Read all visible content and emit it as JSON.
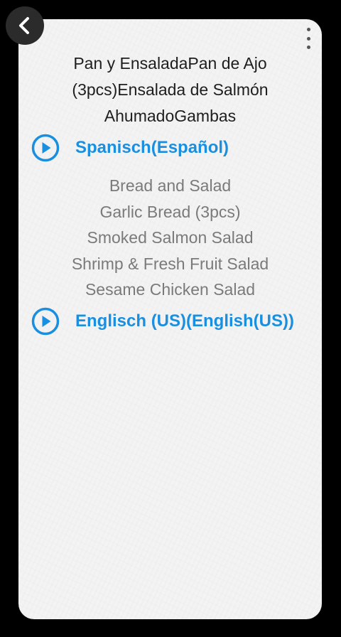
{
  "navigation": {
    "back_icon": "chevron-left-icon",
    "menu_icon": "more-vertical-icon"
  },
  "source": {
    "text": "Pan y EnsaladaPan de Ajo (3pcs)Ensalada de Salmón AhumadoGambas"
  },
  "languages": {
    "spanish_label": "Spanisch(Español)",
    "english_label": "Englisch (US)(English(US))",
    "play_icon": "play-circle-icon",
    "accent_color": "#1a8fe0"
  },
  "translation": {
    "lines": [
      "Bread and Salad",
      "Garlic Bread (3pcs)",
      "Smoked Salmon Salad",
      "Shrimp & Fresh Fruit Salad",
      "Sesame Chicken Salad"
    ]
  }
}
